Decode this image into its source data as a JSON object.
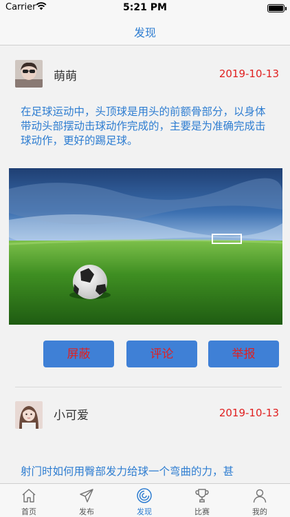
{
  "status_bar": {
    "carrier": "Carrier",
    "time": "5:21 PM"
  },
  "nav": {
    "title": "发现"
  },
  "posts": [
    {
      "user": "萌萌",
      "date": "2019-10-13",
      "text": "在足球运动中，头顶球是用头的前额骨部分，以身体带动头部摆动击球动作完成的，主要是为准确完成击球动作，更好的踢足球。",
      "actions": {
        "block": "屏蔽",
        "comment": "评论",
        "report": "举报"
      }
    },
    {
      "user": "小可爱",
      "date": "2019-10-13",
      "text": "射门时如何用臀部发力给球一个弯曲的力，甚"
    }
  ],
  "tabs": [
    {
      "label": "首页",
      "icon": "home-icon"
    },
    {
      "label": "发布",
      "icon": "send-icon"
    },
    {
      "label": "发现",
      "icon": "discover-icon",
      "active": true
    },
    {
      "label": "比赛",
      "icon": "trophy-icon"
    },
    {
      "label": "我的",
      "icon": "profile-icon"
    }
  ],
  "colors": {
    "accent": "#2e7dd1",
    "date": "#e02020",
    "button_bg": "#3f80d6",
    "button_text": "#e02020"
  }
}
